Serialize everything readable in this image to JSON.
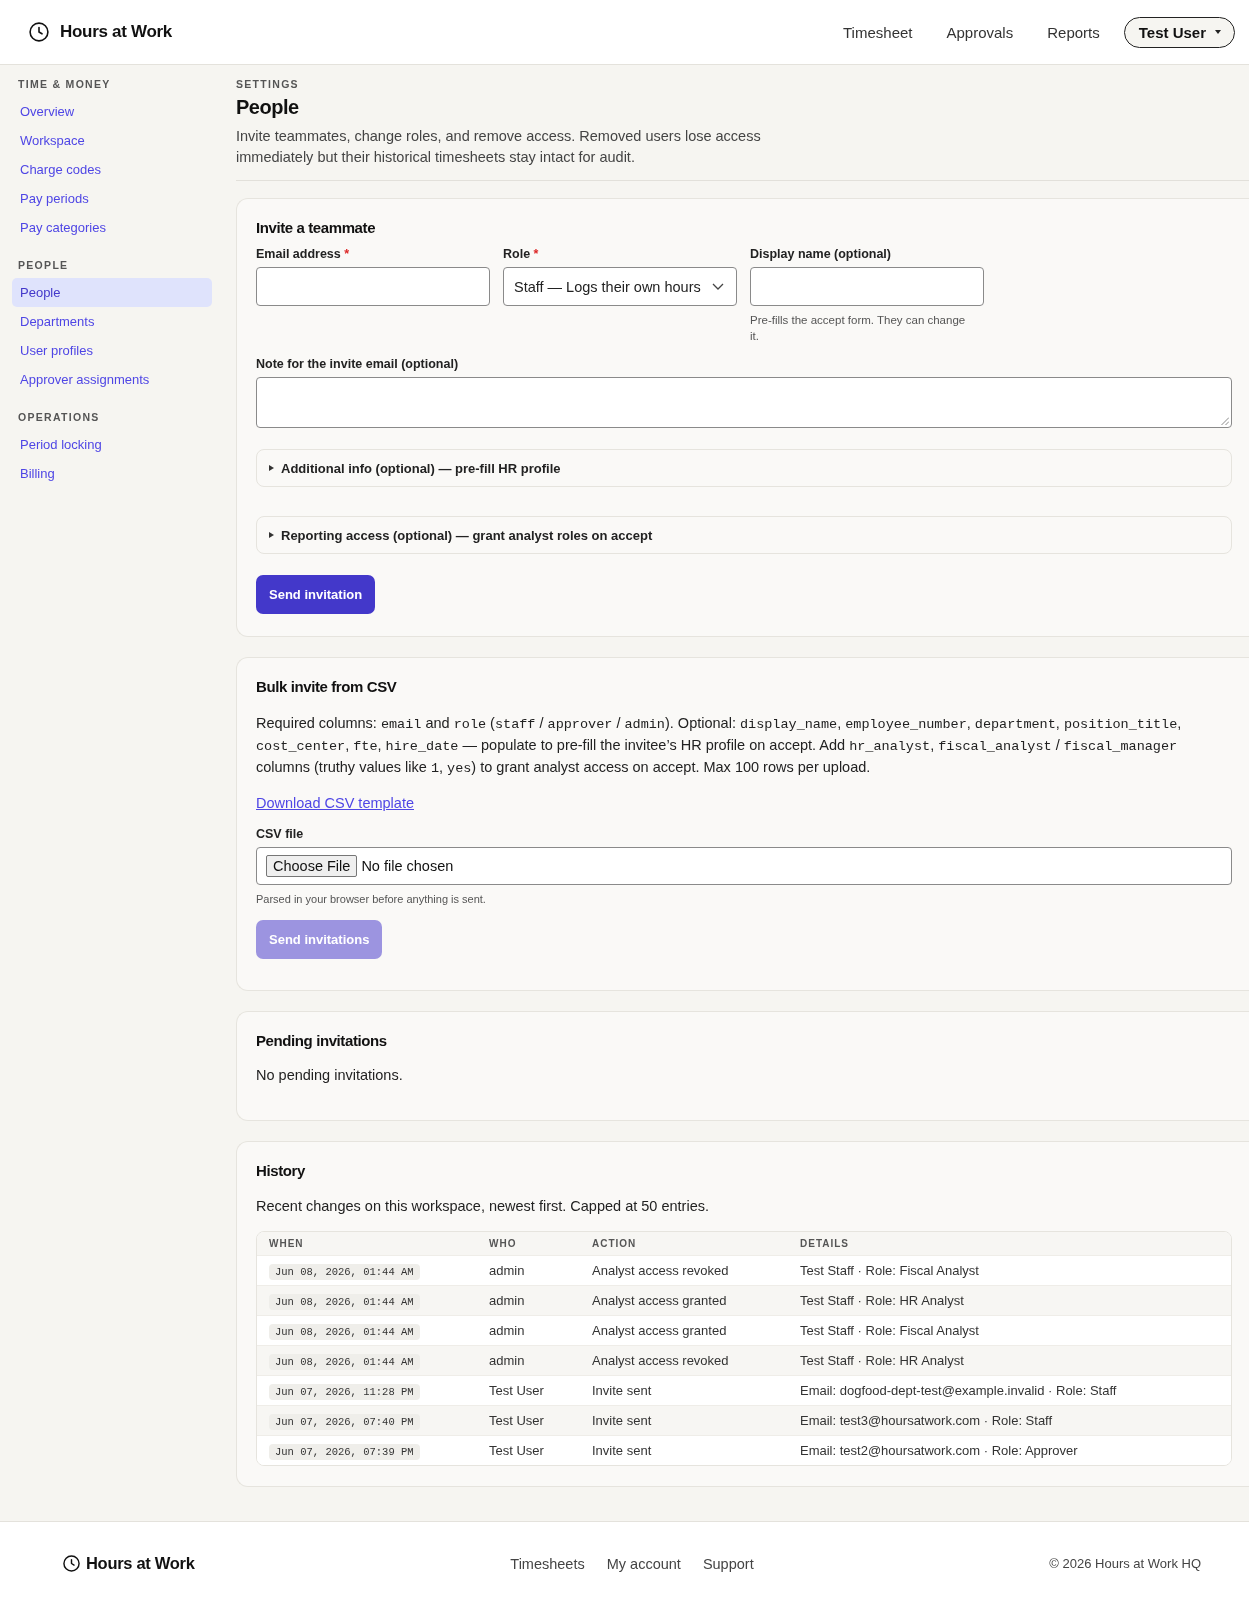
{
  "header": {
    "brand": "Hours at Work",
    "nav": [
      {
        "label": "Timesheet"
      },
      {
        "label": "Approvals"
      },
      {
        "label": "Reports"
      }
    ],
    "user_menu": {
      "label": "Test User"
    }
  },
  "sidebar": {
    "sections": [
      {
        "heading": "TIME & MONEY",
        "items": [
          {
            "label": "Overview",
            "selected": false
          },
          {
            "label": "Workspace",
            "selected": false
          },
          {
            "label": "Charge codes",
            "selected": false
          },
          {
            "label": "Pay periods",
            "selected": false
          },
          {
            "label": "Pay categories",
            "selected": false
          }
        ]
      },
      {
        "heading": "PEOPLE",
        "items": [
          {
            "label": "People",
            "selected": true
          },
          {
            "label": "Departments",
            "selected": false
          },
          {
            "label": "User profiles",
            "selected": false
          },
          {
            "label": "Approver assignments",
            "selected": false
          }
        ]
      },
      {
        "heading": "OPERATIONS",
        "items": [
          {
            "label": "Period locking",
            "selected": false
          },
          {
            "label": "Billing",
            "selected": false
          }
        ]
      }
    ]
  },
  "page": {
    "eyebrow": "SETTINGS",
    "title": "People",
    "description": "Invite teammates, change roles, and remove access. Removed users lose access immediately but their historical timesheets stay intact for audit."
  },
  "invite_card": {
    "title": "Invite a teammate",
    "fields": [
      {
        "kind": "email",
        "label": "Email address",
        "required_mark": "*"
      },
      {
        "kind": "select",
        "label": "Role",
        "required_mark": "*",
        "value": "Staff — Logs their own hours"
      },
      {
        "kind": "text",
        "label": "Display name (optional)",
        "help": "Pre-fills the accept form. They can change it."
      }
    ],
    "note": {
      "label": "Note for the invite email (optional)"
    },
    "sections": [
      {
        "summary": "Additional info (optional) — pre-fill HR profile",
        "expanded": false
      },
      {
        "summary": "Reporting access (optional) — grant analyst roles on accept",
        "expanded": false
      }
    ],
    "submit": {
      "label": "Send invitation",
      "disabled": false
    }
  },
  "bulk_card": {
    "title": "Bulk invite from CSV",
    "description_segments": [
      {
        "kind": "text",
        "text": "Required columns: "
      },
      {
        "kind": "code",
        "text": "email"
      },
      {
        "kind": "text",
        "text": " and "
      },
      {
        "kind": "code",
        "text": "role"
      },
      {
        "kind": "text",
        "text": " ("
      },
      {
        "kind": "code",
        "text": "staff"
      },
      {
        "kind": "text",
        "text": " / "
      },
      {
        "kind": "code",
        "text": "approver"
      },
      {
        "kind": "text",
        "text": " / "
      },
      {
        "kind": "code",
        "text": "admin"
      },
      {
        "kind": "text",
        "text": "). Optional: "
      },
      {
        "kind": "code",
        "text": "display_name"
      },
      {
        "kind": "text",
        "text": ", "
      },
      {
        "kind": "code",
        "text": "employee_number"
      },
      {
        "kind": "text",
        "text": ", "
      },
      {
        "kind": "code",
        "text": "department"
      },
      {
        "kind": "text",
        "text": ", "
      },
      {
        "kind": "code",
        "text": "position_title"
      },
      {
        "kind": "text",
        "text": ", "
      },
      {
        "kind": "code",
        "text": "cost_center"
      },
      {
        "kind": "text",
        "text": ", "
      },
      {
        "kind": "code",
        "text": "fte"
      },
      {
        "kind": "text",
        "text": ", "
      },
      {
        "kind": "code",
        "text": "hire_date"
      },
      {
        "kind": "text",
        "text": " — populate to pre-fill the invitee’s HR profile on accept. Add "
      },
      {
        "kind": "code",
        "text": "hr_analyst"
      },
      {
        "kind": "text",
        "text": ", "
      },
      {
        "kind": "code",
        "text": "fiscal_analyst"
      },
      {
        "kind": "text",
        "text": " / "
      },
      {
        "kind": "code",
        "text": "fiscal_manager"
      },
      {
        "kind": "text",
        "text": " columns (truthy values like "
      },
      {
        "kind": "code",
        "text": "1"
      },
      {
        "kind": "text",
        "text": ", "
      },
      {
        "kind": "code",
        "text": "yes"
      },
      {
        "kind": "text",
        "text": ") to grant analyst access on accept. Max 100 rows per upload."
      }
    ],
    "template_link": "Download CSV template",
    "file": {
      "label": "CSV file",
      "button": "Choose File",
      "status": "No file chosen",
      "help": "Parsed in your browser before anything is sent."
    },
    "submit": {
      "label": "Send invitations",
      "disabled": true
    }
  },
  "pending_card": {
    "title": "Pending invitations",
    "empty_text": "No pending invitations."
  },
  "history_card": {
    "title": "History",
    "description": "Recent changes on this workspace, newest first. Capped at 50 entries.",
    "table": {
      "columns": [
        "WHEN",
        "WHO",
        "ACTION",
        "DETAILS"
      ],
      "rows": [
        {
          "when": "Jun 08, 2026, 01:44 AM",
          "who": "admin",
          "action": "Analyst access revoked",
          "details": "Test Staff · Role: Fiscal Analyst"
        },
        {
          "when": "Jun 08, 2026, 01:44 AM",
          "who": "admin",
          "action": "Analyst access granted",
          "details": "Test Staff · Role: HR Analyst"
        },
        {
          "when": "Jun 08, 2026, 01:44 AM",
          "who": "admin",
          "action": "Analyst access granted",
          "details": "Test Staff · Role: Fiscal Analyst"
        },
        {
          "when": "Jun 08, 2026, 01:44 AM",
          "who": "admin",
          "action": "Analyst access revoked",
          "details": "Test Staff · Role: HR Analyst"
        },
        {
          "when": "Jun 07, 2026, 11:28 PM",
          "who": "Test User",
          "action": "Invite sent",
          "details": "Email: dogfood-dept-test@example.invalid · Role: Staff"
        },
        {
          "when": "Jun 07, 2026, 07:40 PM",
          "who": "Test User",
          "action": "Invite sent",
          "details": "Email: test3@hoursatwork.com · Role: Staff"
        },
        {
          "when": "Jun 07, 2026, 07:39 PM",
          "who": "Test User",
          "action": "Invite sent",
          "details": "Email: test2@hoursatwork.com · Role: Approver"
        }
      ]
    }
  },
  "footer": {
    "brand": "Hours at Work",
    "links": [
      "Timesheets",
      "My account",
      "Support"
    ],
    "copyright": "© 2026 Hours at Work HQ"
  }
}
